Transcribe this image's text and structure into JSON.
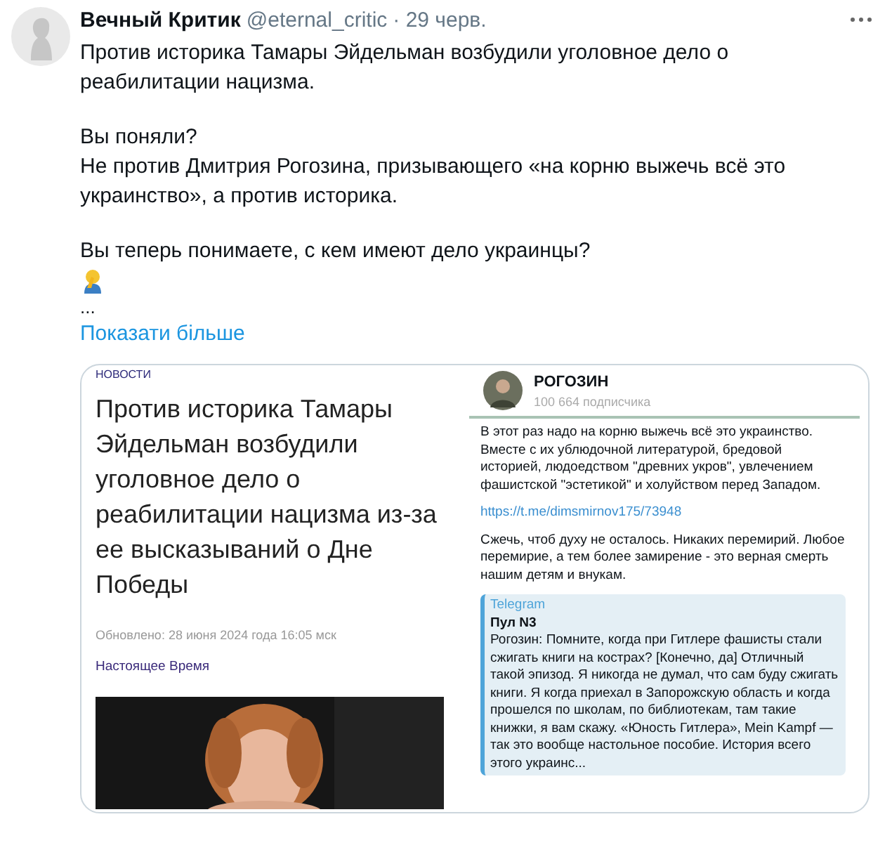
{
  "tweet": {
    "author_name": "Вечный Критик",
    "handle": "@eternal_critic",
    "date": "· 29 черв.",
    "paragraphs": [
      "Против историка Тамары Эйдельман возбудили уголовное дело о реабилитации нацизма.",
      "Вы поняли?\nНе против Дмитрия Рогозина, призывающего «на корню выжечь всё это украинство», а против историка.",
      "Вы теперь понимаете, с кем имеют дело украинцы?"
    ],
    "ellipsis": "...",
    "show_more": "Показати більше"
  },
  "embed": {
    "article": {
      "section": "НОВОСТИ",
      "headline": "Против историка Тамары Эйдельман возбудили уголовное дело о реабилитации нацизма из-за ее высказываний о Дне Победы",
      "updated": "Обновлено: 28 июня 2024 года 16:05 мск",
      "source": "Настоящее Время"
    },
    "telegram": {
      "channel": "РОГОЗИН",
      "subscribers": "100 664 подписчика",
      "post": [
        "В этот раз надо на корню выжечь всё это украинство. Вместе с их ублюдочной литературой, бредовой историей, людоедством \"древних укров\", увлечением фашистской \"эстетикой\" и холуйством перед Западом."
      ],
      "link": "https://t.me/dimsmirnov175/73948",
      "post_after": "Сжечь, чтоб духу не осталось. Никаких перемирий. Любое перемирие, а тем более замирение - это верная смерть нашим детям и внукам.",
      "quote": {
        "source": "Telegram",
        "title": "Пул N3",
        "text": "Рогозин: Помните, когда при Гитлере фашисты стали сжигать книги на кострах? [Конечно, да] Отличный такой эпизод. Я никогда не думал, что сам буду сжигать книги. Я когда приехал в Запорожскую область и когда прошелся по школам, по библиотекам, там такие книжки, я вам скажу. «Юность Гитлера», Mein Kampf — так это вообще настольное пособие. История всего этого украинс..."
      }
    }
  }
}
